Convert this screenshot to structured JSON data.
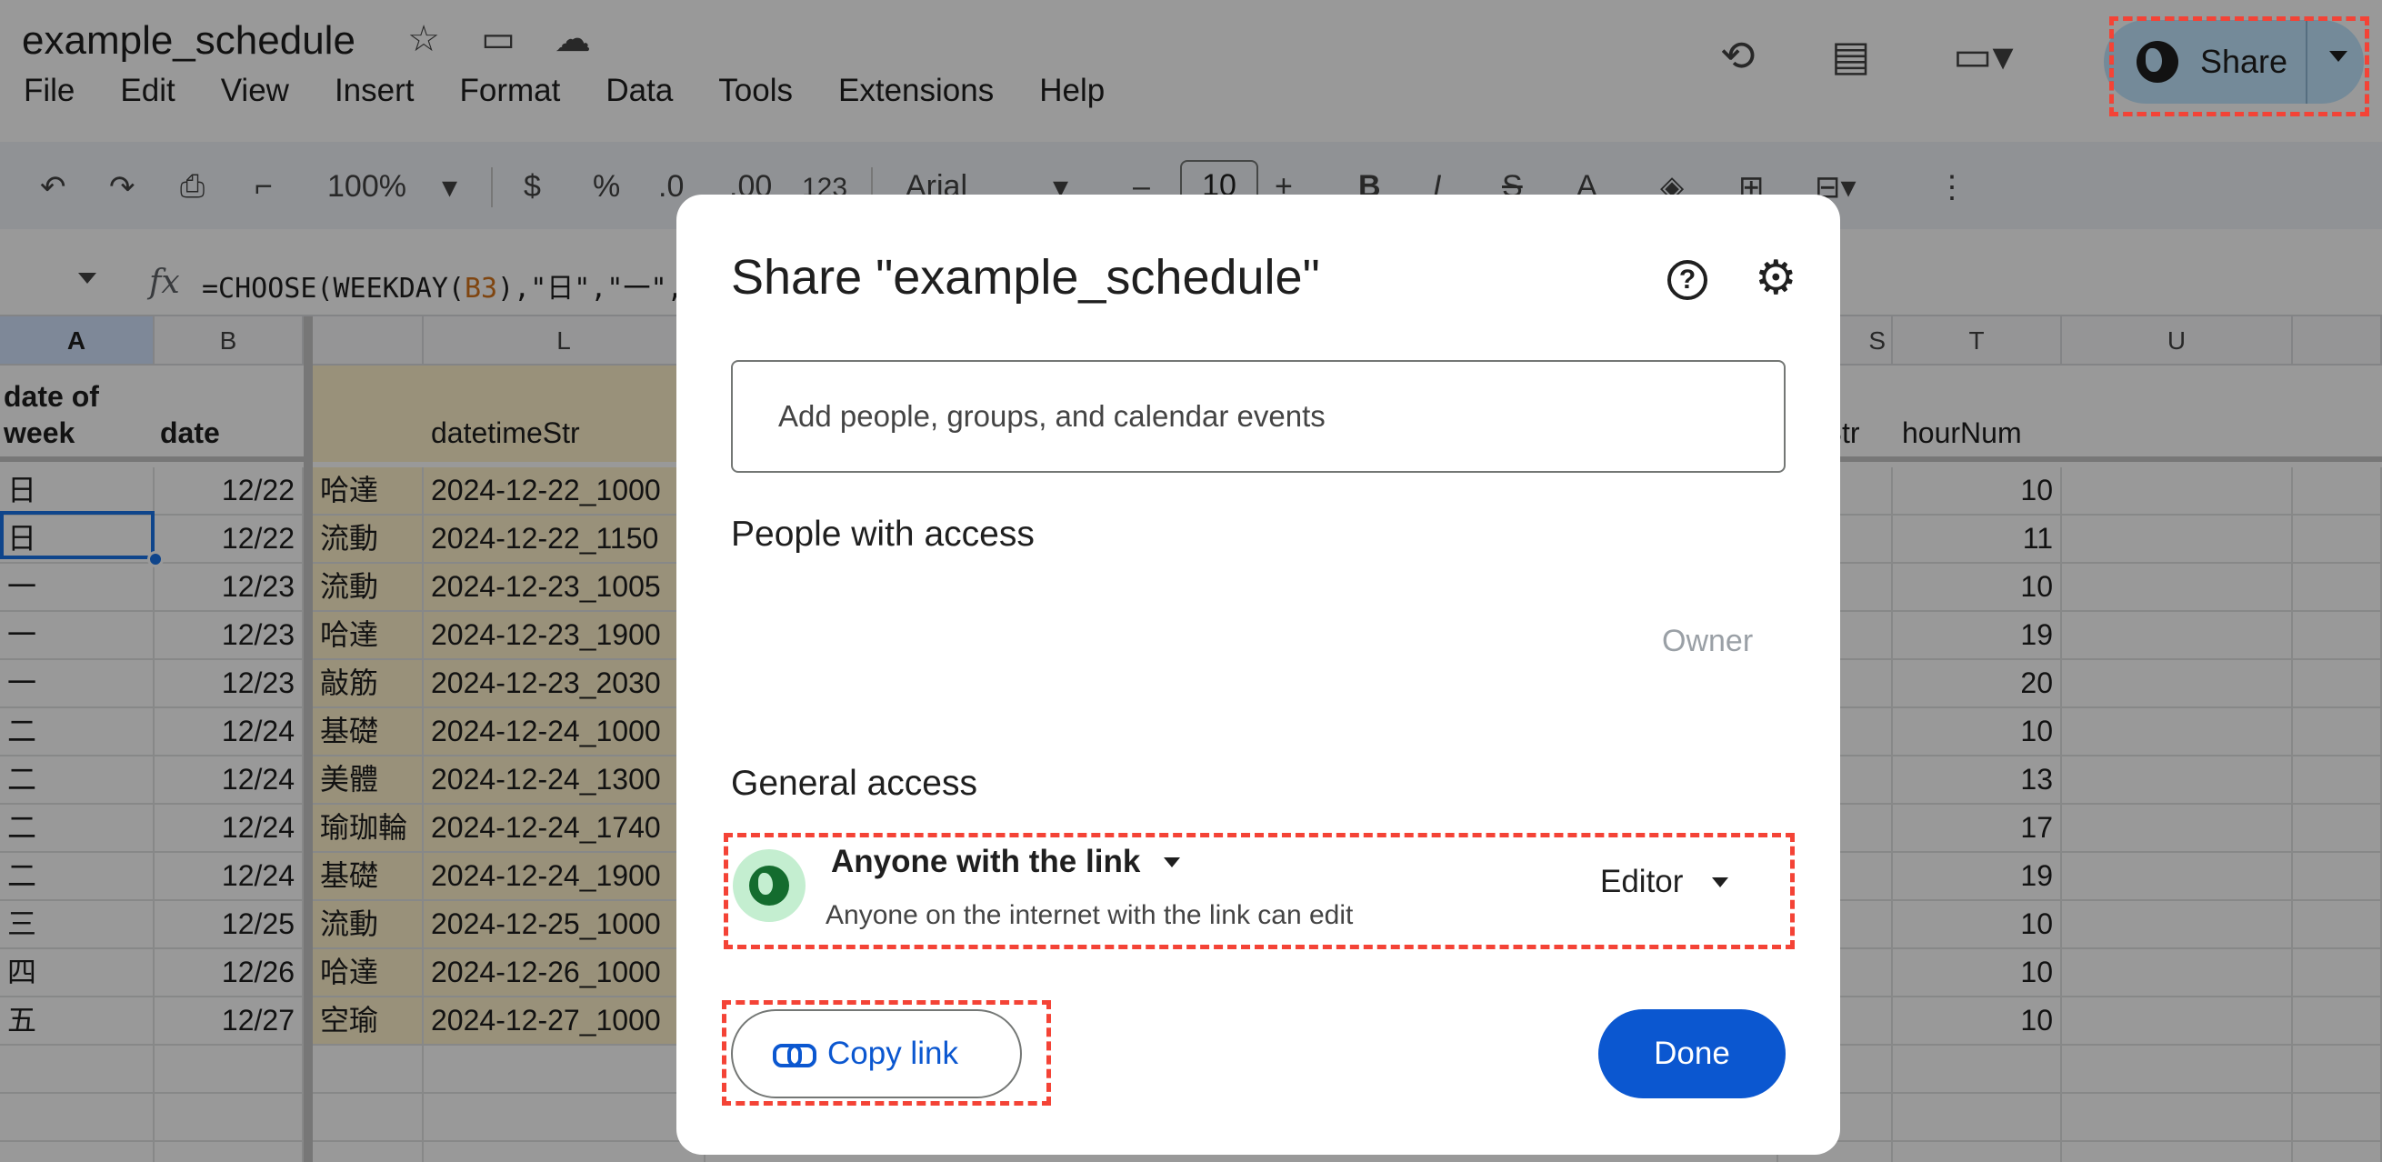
{
  "app": {
    "doc_title": "example_schedule",
    "menu": [
      "File",
      "Edit",
      "View",
      "Insert",
      "Format",
      "Data",
      "Tools",
      "Extensions",
      "Help"
    ],
    "share_label": "Share"
  },
  "toolbar": {
    "zoom": "100%",
    "currency": "$",
    "percent": "%",
    "dec_decrease": ".0",
    "dec_increase": ".00",
    "number_format": "123",
    "font": "Arial",
    "minus": "–",
    "font_size": "10",
    "plus": "+",
    "bold": "B",
    "italic": "I",
    "strike": "S",
    "text_color": "A"
  },
  "formula": {
    "fx": "fx",
    "prefix": "=CHOOSE(WEEKDAY(",
    "ref": "B3",
    "suffix": "),\"日\",\"一\","
  },
  "grid": {
    "columns": {
      "A": "A",
      "B": "B",
      "L": "L",
      "S": "S",
      "T": "T",
      "U": "U"
    },
    "headers": {
      "date_of_week_line1": "date of",
      "date_of_week_line2": "week",
      "date": "date",
      "datetimeStr": "datetimeStr",
      "partial_str": "rStr",
      "hourNum": "hourNum"
    },
    "rows": [
      {
        "dow": "日",
        "date": "12/22",
        "cls": "哈達",
        "dt": "2024-12-22_1000",
        "hour": "10"
      },
      {
        "dow": "日",
        "date": "12/22",
        "cls": "流動",
        "dt": "2024-12-22_1150",
        "hour": "11"
      },
      {
        "dow": "一",
        "date": "12/23",
        "cls": "流動",
        "dt": "2024-12-23_1005",
        "hour": "10"
      },
      {
        "dow": "一",
        "date": "12/23",
        "cls": "哈達",
        "dt": "2024-12-23_1900",
        "hour": "19"
      },
      {
        "dow": "一",
        "date": "12/23",
        "cls": "敲筋",
        "dt": "2024-12-23_2030",
        "hour": "20"
      },
      {
        "dow": "二",
        "date": "12/24",
        "cls": "基礎",
        "dt": "2024-12-24_1000",
        "hour": "10"
      },
      {
        "dow": "二",
        "date": "12/24",
        "cls": "美體",
        "dt": "2024-12-24_1300",
        "hour": "13"
      },
      {
        "dow": "二",
        "date": "12/24",
        "cls": "瑜珈輪",
        "dt": "2024-12-24_1740",
        "hour": "17"
      },
      {
        "dow": "二",
        "date": "12/24",
        "cls": "基礎",
        "dt": "2024-12-24_1900",
        "hour": "19"
      },
      {
        "dow": "三",
        "date": "12/25",
        "cls": "流動",
        "dt": "2024-12-25_1000",
        "hour": "10"
      },
      {
        "dow": "四",
        "date": "12/26",
        "cls": "哈達",
        "dt": "2024-12-26_1000",
        "hour": "10"
      },
      {
        "dow": "五",
        "date": "12/27",
        "cls": "空瑜",
        "dt": "2024-12-27_1000",
        "hour": "10"
      }
    ]
  },
  "dialog": {
    "title": "Share \"example_schedule\"",
    "help_icon": "?",
    "add_placeholder": "Add people, groups, and calendar events",
    "people_title": "People with access",
    "owner_label": "Owner",
    "general_title": "General access",
    "scope": "Anyone with the link",
    "scope_desc": "Anyone on the internet with the link can edit",
    "role": "Editor",
    "copy_link": "Copy link",
    "done": "Done"
  },
  "colors": {
    "highlight_dashed": "#f44336",
    "primary": "#0b57d0",
    "share_button": "#c2e7ff",
    "cell_highlight": "#fff2cc"
  }
}
